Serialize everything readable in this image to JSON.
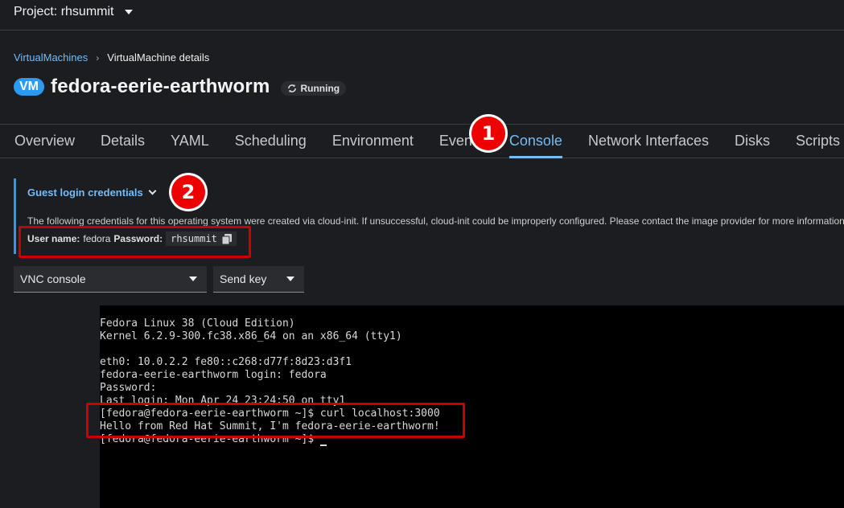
{
  "topbar": {
    "project_label": "Project: rhsummit"
  },
  "breadcrumb": {
    "parent": "VirtualMachines",
    "current": "VirtualMachine details"
  },
  "header": {
    "badge": "VM",
    "title": "fedora-eerie-earthworm",
    "status": "Running"
  },
  "tabs": [
    {
      "label": "Overview"
    },
    {
      "label": "Details"
    },
    {
      "label": "YAML"
    },
    {
      "label": "Scheduling"
    },
    {
      "label": "Environment"
    },
    {
      "label": "Events"
    },
    {
      "label": "Console"
    },
    {
      "label": "Network Interfaces"
    },
    {
      "label": "Disks"
    },
    {
      "label": "Scripts"
    }
  ],
  "markers": {
    "one": "1",
    "two": "2"
  },
  "credentials": {
    "toggle_label": "Guest login credentials",
    "description": "The following credentials for this operating system were created via cloud-init. If unsuccessful, cloud-init could be improperly configured. Please contact the image provider for more information.",
    "user_label": "User name:",
    "user_value": "fedora",
    "password_label": "Password:",
    "password_value": "rhsummit"
  },
  "console_select": {
    "value": "VNC console"
  },
  "send_key": {
    "label": "Send key"
  },
  "terminal": {
    "lines": [
      "Fedora Linux 38 (Cloud Edition)",
      "Kernel 6.2.9-300.fc38.x86_64 on an x86_64 (tty1)",
      "",
      "eth0: 10.0.2.2 fe80::c268:d77f:8d23:d3f1",
      "fedora-eerie-earthworm login: fedora",
      "Password:",
      "Last login: Mon Apr 24 23:24:50 on tty1",
      "[fedora@fedora-eerie-earthworm ~]$ curl localhost:3000",
      "Hello from Red Hat Summit, I'm fedora-eerie-earthworm!",
      "[fedora@fedora-eerie-earthworm ~]$ "
    ]
  },
  "colors": {
    "accent": "#73bcf7",
    "badge": "#2b9af3",
    "marker": "#ee0000",
    "highlight": "#c80000"
  }
}
